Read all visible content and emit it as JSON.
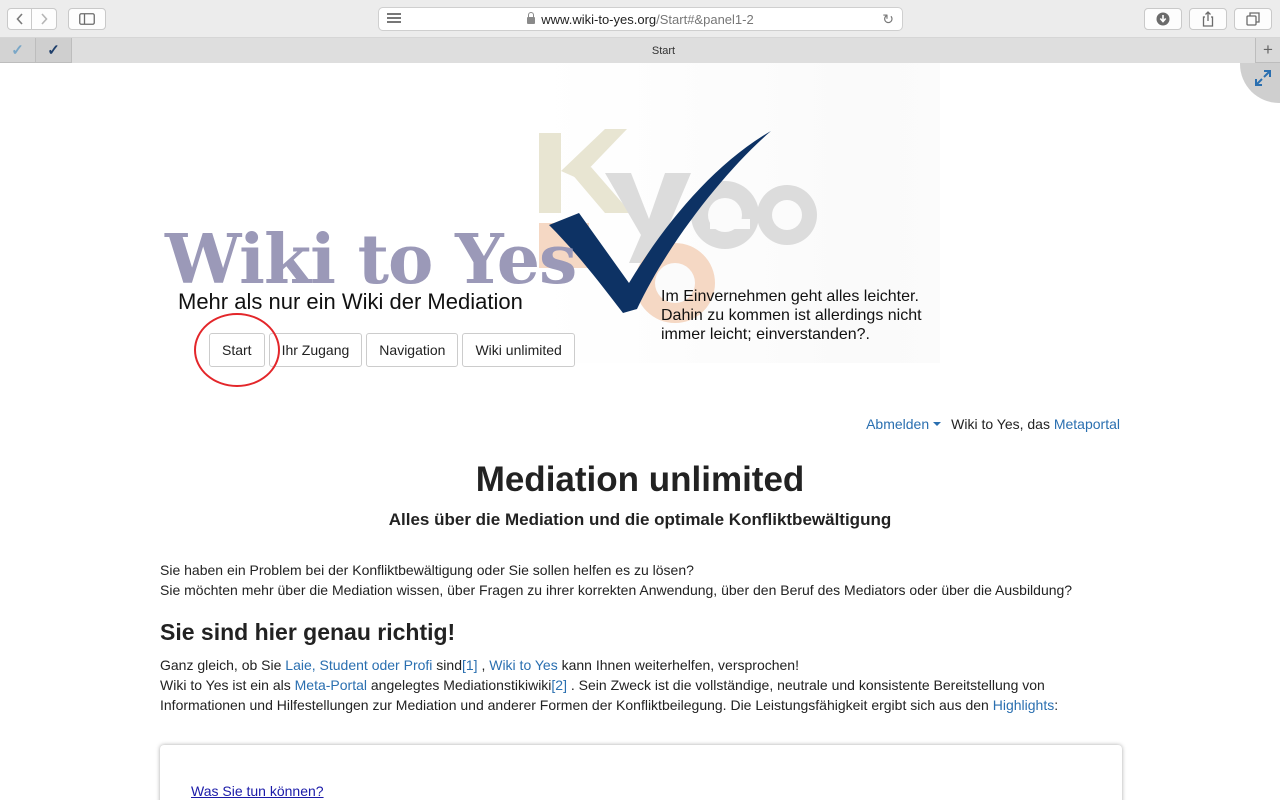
{
  "browser": {
    "url_host": "www.wiki-to-yes.org",
    "url_path": "/Start#&panel1-2",
    "tab_title": "Start",
    "new_tab_label": "+"
  },
  "site": {
    "title": "Wiki to Yes",
    "subtitle": "Mehr als nur ein Wiki der Mediation",
    "slogan": "Im Einvernehmen geht alles leichter. Dahin zu kommen ist allerdings nicht immer leicht; einverstanden?."
  },
  "nav": [
    {
      "label": "Start"
    },
    {
      "label": "Ihr Zugang"
    },
    {
      "label": "Navigation"
    },
    {
      "label": "Wiki unlimited"
    }
  ],
  "userbar": {
    "logout": "Abmelden",
    "portal_prefix": "Wiki to Yes, das ",
    "portal_link": "Metaportal"
  },
  "main": {
    "title": "Mediation unlimited",
    "subtitle": "Alles über die Mediation und die optimale Konfliktbewältigung",
    "intro_line1": "Sie haben ein Problem bei der Konfliktbewältigung oder Sie sollen helfen es zu lösen?",
    "intro_line2": "Sie möchten mehr über die Mediation wissen, über Fragen zu ihrer korrekten Anwendung, über den Beruf des Mediators oder über die Ausbildung?",
    "heading": "Sie sind hier genau richtig!",
    "p1_a": "Ganz gleich, ob Sie ",
    "p1_link1": "Laie, Student oder Profi",
    "p1_b": " sind",
    "p1_ref1": "[1]",
    "p1_c": " , ",
    "p1_link2": "Wiki to Yes",
    "p1_d": " kann Ihnen weiterhelfen, versprochen!",
    "p2_a": "Wiki to Yes ist ein als ",
    "p2_link1": "Meta-Portal",
    "p2_b": " angelegtes Mediationstikiwiki",
    "p2_ref2": "[2]",
    "p2_c": " . Sein Zweck ist die vollständige, neutrale und konsistente Bereitstellung von Informationen und Hilfestellungen zur Mediation und anderer Formen der Konfliktbeilegung. Die Leistungsfähigkeit ergibt sich aus den ",
    "p2_link2": "Highlights",
    "p2_d": ":",
    "card_link": "Was Sie tun können?"
  },
  "colors": {
    "title": "#9b99b8",
    "checkmark": "#0d3264",
    "link": "#2a6fb0",
    "ring": "#e3262a"
  },
  "icons": {
    "back": "chevron-left-icon",
    "forward": "chevron-right-icon",
    "sidebar": "sidebar-icon",
    "reader": "reader-icon",
    "lock": "lock-icon",
    "reload": "reload-icon",
    "download": "download-icon",
    "share": "share-icon",
    "tabs": "tabs-icon",
    "expand": "expand-icon",
    "checkmark": "checkmark-icon"
  }
}
